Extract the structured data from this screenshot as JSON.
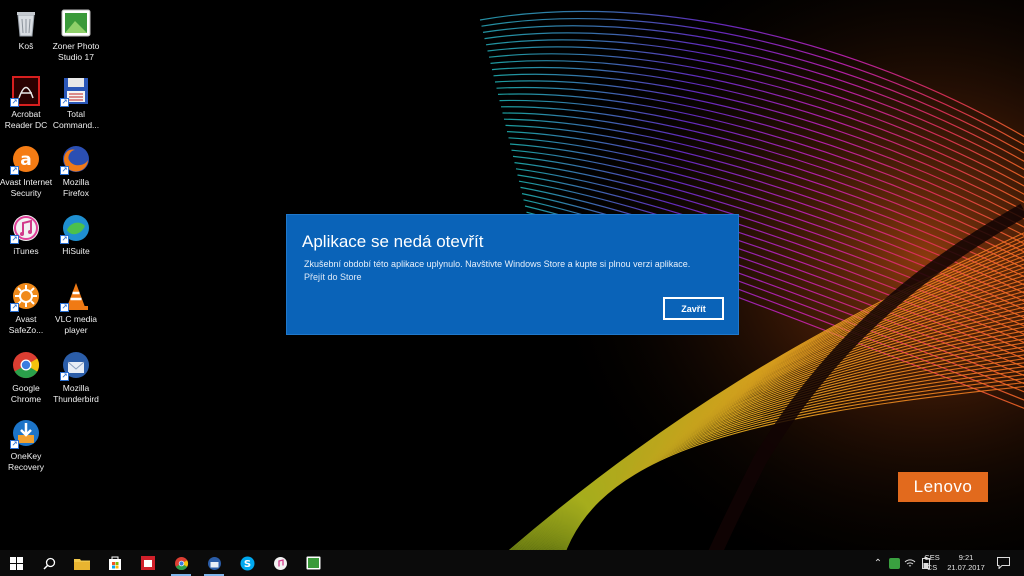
{
  "desktop": {
    "icons": [
      {
        "name": "recycle-bin",
        "label": "Koš"
      },
      {
        "name": "zoner-photo-studio",
        "label": "Zoner Photo\nStudio 17"
      },
      {
        "name": "acrobat-reader",
        "label": "Acrobat\nReader DC"
      },
      {
        "name": "total-commander",
        "label": "Total\nCommand..."
      },
      {
        "name": "avast-internet-security",
        "label": "Avast Internet\nSecurity"
      },
      {
        "name": "mozilla-firefox",
        "label": "Mozilla\nFirefox"
      },
      {
        "name": "itunes",
        "label": "iTunes"
      },
      {
        "name": "hisuite",
        "label": "HiSuite"
      },
      {
        "name": "avast-safezone",
        "label": "Avast\nSafeZo..."
      },
      {
        "name": "vlc-media-player",
        "label": "VLC media\nplayer"
      },
      {
        "name": "google-chrome",
        "label": "Google\nChrome"
      },
      {
        "name": "mozilla-thunderbird",
        "label": "Mozilla\nThunderbird"
      },
      {
        "name": "onekey-recovery",
        "label": "OneKey\nRecovery"
      }
    ]
  },
  "dialog": {
    "title": "Aplikace se nedá otevřít",
    "message": "Zkušební období této aplikace uplynulo. Navštivte Windows Store a kupte si plnou verzi aplikace.",
    "link": "Přejít do Store",
    "button": "Zavřít",
    "background_color": "#0a63b8"
  },
  "brand": {
    "logo_text": "Lenovo",
    "color": "#e26a1d"
  },
  "taskbar": {
    "items": [
      "start-icon",
      "search-icon",
      "file-explorer-icon",
      "store-icon",
      "app-icon",
      "chrome-icon",
      "thunderbird-icon",
      "skype-icon",
      "itunes-icon",
      "zoner-icon"
    ],
    "tray": {
      "language_top": "CES",
      "language_bottom": "CS",
      "time": "9:21",
      "date": "21.07.2017"
    }
  }
}
